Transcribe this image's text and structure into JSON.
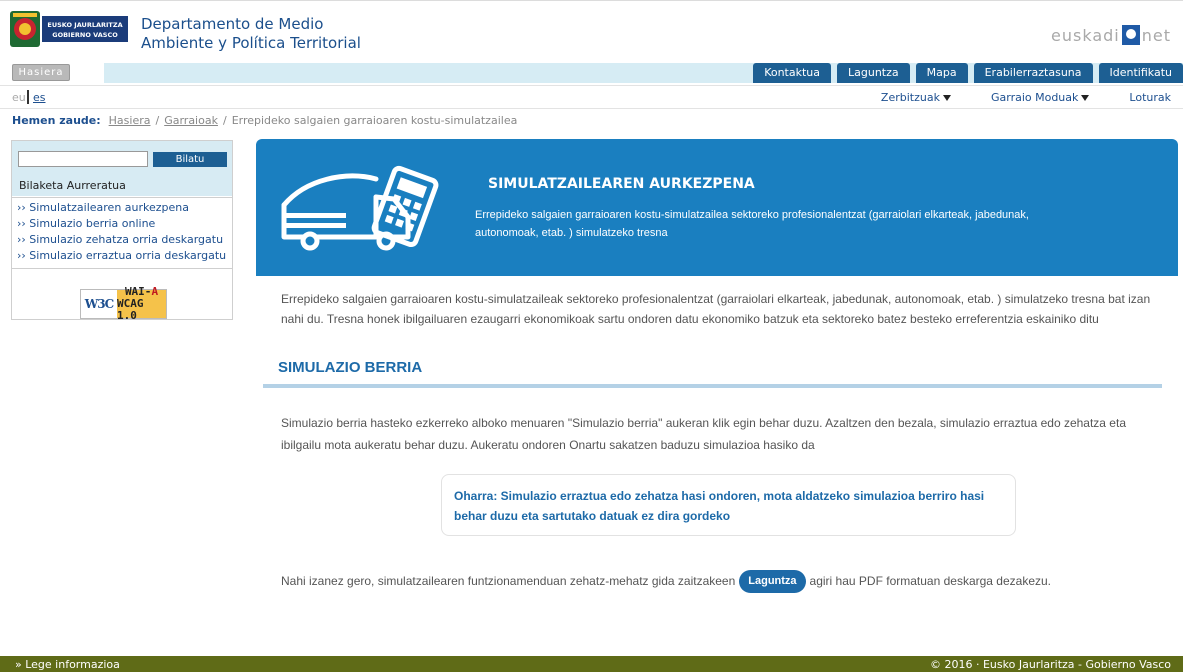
{
  "header": {
    "logo_line1": "EUSKO JAURLARITZA",
    "logo_line2": "GOBIERNO VASCO",
    "dept_title_line1": "Departamento de Medio",
    "dept_title_line2": "Ambiente y Política Territorial",
    "brand_left": "euskadi",
    "brand_right": "net"
  },
  "topbar": {
    "home_label": "Hasiera",
    "tabs": [
      "Kontaktua",
      "Laguntza",
      "Mapa",
      "Erabilerraztasuna",
      "Identifikatu"
    ]
  },
  "lang": {
    "eu": "eu",
    "es": "es"
  },
  "menu2": {
    "services": "Zerbitzuak",
    "transport_modes": "Garraio Moduak",
    "links": "Loturak"
  },
  "breadcrumb": {
    "label": "Hemen zaude:",
    "items": [
      "Hasiera",
      "Garraioak"
    ],
    "current": "Errepideko salgaien garraioaren kostu-simulatzailea",
    "separator": "/"
  },
  "sidebar": {
    "search_placeholder": "",
    "search_button": "Bilatu",
    "advanced_search": "Bilaketa Aurreratua",
    "links": [
      "›› Simulatzailearen aurkezpena",
      "›› Simulazio berria online",
      "›› Simulazio zehatza orria deskargatu",
      "›› Simulazio erraztua orria deskargatu"
    ],
    "badge_w3c": "W3C",
    "badge_wai": "WAI-",
    "badge_a": "A",
    "badge_wcag": "WCAG 1.0"
  },
  "banner": {
    "title": "SIMULATZAILEAREN AURKEZPENA",
    "description": "Errepideko salgaien garraioaren kostu-simulatzailea sektoreko profesionalentzat (garraiolari elkarteak, jabedunak, autonomoak, etab. ) simulatzeko tresna",
    "icon": "truck-calculator-icon"
  },
  "content": {
    "intro": "Errepideko salgaien garraioaren kostu-simulatzaileak sektoreko profesionalentzat (garraiolari elkarteak, jabedunak, autonomoak, etab. ) simulatzeko tresna bat izan nahi du. Tresna honek ibilgailuaren ezaugarri ekonomikoak sartu ondoren datu ekonomiko batzuk eta sektoreko batez besteko erreferentzia eskainiko ditu",
    "section_title": "SIMULAZIO BERRIA",
    "para1": "Simulazio berria hasteko ezkerreko alboko menuaren \"Simulazio berria\" aukeran klik egin behar duzu. Azaltzen den bezala, simulazio erraztua edo zehatza eta ibilgailu mota aukeratu behar duzu. Aukeratu ondoren Onartu sakatzen baduzu simulazioa hasiko da",
    "note": "Oharra: Simulazio erraztua edo zehatza hasi ondoren, mota aldatzeko simulazioa berriro hasi behar duzu eta sartutako datuak ez dira gordeko",
    "para2_before": "Nahi izanez gero, simulatzailearen funtzionamenduan zehatz-mehatz gida zaitzakeen",
    "help_button": "Laguntza",
    "para2_after": "agiri hau PDF formatuan deskarga dezakezu."
  },
  "footer": {
    "legal": "» Lege informazioa",
    "copyright": "© 2016 · Eusko Jaurlaritza - Gobierno Vasco"
  },
  "colors": {
    "primary_blue": "#1d5f93",
    "banner_blue": "#1a7fc0",
    "footer_olive": "#5f6b17",
    "light_blue_bg": "#d6ecf4"
  }
}
